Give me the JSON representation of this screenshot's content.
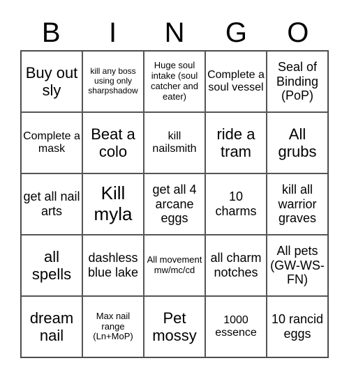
{
  "header": [
    "B",
    "I",
    "N",
    "G",
    "O"
  ],
  "cells": [
    {
      "text": "Buy out sly",
      "size": "s-l"
    },
    {
      "text": "kill any boss using only sharpshadow",
      "size": "s-xxs"
    },
    {
      "text": "Huge soul intake (soul catcher and eater)",
      "size": "s-xs"
    },
    {
      "text": "Complete a soul vessel",
      "size": "s-s"
    },
    {
      "text": "Seal of Binding (PoP)",
      "size": "s-m"
    },
    {
      "text": "Complete a mask",
      "size": "s-s"
    },
    {
      "text": "Beat a colo",
      "size": "s-l"
    },
    {
      "text": "kill nailsmith",
      "size": "s-s"
    },
    {
      "text": "ride a tram",
      "size": "s-l"
    },
    {
      "text": "All grubs",
      "size": "s-l"
    },
    {
      "text": "get all nail arts",
      "size": "s-m"
    },
    {
      "text": "Kill myla",
      "size": "s-xl"
    },
    {
      "text": "get all 4 arcane eggs",
      "size": "s-m"
    },
    {
      "text": "10 charms",
      "size": "s-m"
    },
    {
      "text": "kill all warrior graves",
      "size": "s-m"
    },
    {
      "text": "all spells",
      "size": "s-l"
    },
    {
      "text": "dashless blue lake",
      "size": "s-m"
    },
    {
      "text": "All movement mw/mc/cd",
      "size": "s-xs"
    },
    {
      "text": "all charm notches",
      "size": "s-m"
    },
    {
      "text": "All pets (GW-WS-FN)",
      "size": "s-m"
    },
    {
      "text": "dream nail",
      "size": "s-l"
    },
    {
      "text": "Max nail range (Ln+MoP)",
      "size": "s-xs"
    },
    {
      "text": "Pet mossy",
      "size": "s-l"
    },
    {
      "text": "1000 essence",
      "size": "s-s"
    },
    {
      "text": "10 rancid eggs",
      "size": "s-m"
    }
  ]
}
